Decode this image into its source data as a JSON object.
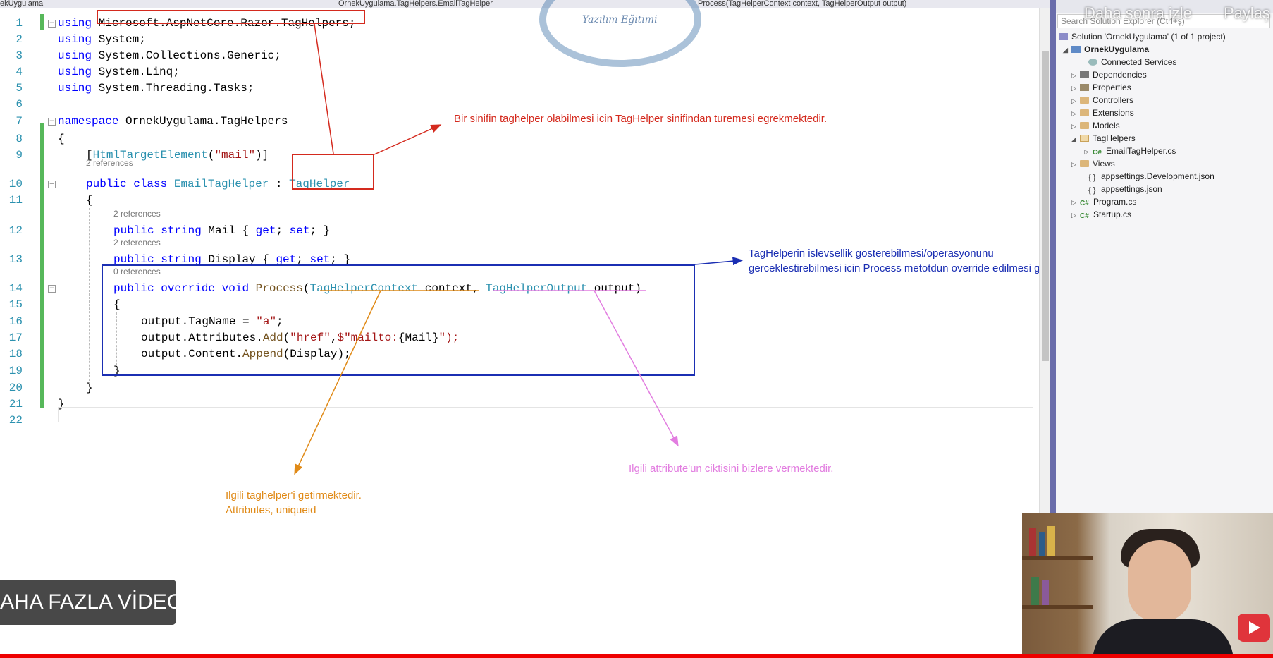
{
  "topbar": {
    "project_tab": "ekUygulama",
    "file_path": "OrnekUygulama.TagHelpers.EmailTagHelper",
    "member_dropdown": "Process(TagHelperContext context, TagHelperOutput output)"
  },
  "youtube": {
    "watch_later": "Daha sonra izle",
    "share": "Paylaş",
    "more_videos": "AHA FAZLA VİDEO"
  },
  "watermark": {
    "subtitle": "Yazılım Eğitimi"
  },
  "code": {
    "line_numbers": [
      "1",
      "2",
      "3",
      "4",
      "5",
      "6",
      "7",
      "8",
      "9",
      "10",
      "11",
      "12",
      "13",
      "14",
      "15",
      "16",
      "17",
      "18",
      "19",
      "20",
      "21",
      "22"
    ],
    "l1": "Microsoft.AspNetCore.Razor.TagHelpers;",
    "l2": "System;",
    "l3": "System.Collections.Generic;",
    "l4": "System.Linq;",
    "l5": "System.Threading.Tasks;",
    "l7": "OrnekUygulama.TagHelpers",
    "l9_attr": "HtmlTargetElement",
    "l9_str": "\"mail\"",
    "l10_class": "EmailTagHelper",
    "l10_base": "TagHelper",
    "l12_prop": " Mail { ",
    "l13_prop": " Display { ",
    "l14_method": "Process",
    "l14_p1type": "TagHelperContext",
    "l14_p1": " context, ",
    "l14_p2type": "TagHelperOutput",
    "l14_p2": " output)",
    "l16": "output.TagName = ",
    "l16_str": "\"a\"",
    "l17a": "output.Attributes.",
    "l17_method": "Add",
    "l17_str1": "\"href\"",
    "l17_str2": "$\"mailto:",
    "l17_interp": "{Mail}",
    "l17_end": "\");",
    "l18a": "output.Content.",
    "l18_method": "Append",
    "l18_end": "(Display);",
    "refs_2": "2 references",
    "refs_0": "0 references",
    "kw_using": "using",
    "kw_namespace": "namespace",
    "kw_public": "public",
    "kw_class": "class",
    "kw_string": "string",
    "kw_override": "override",
    "kw_void": "void",
    "kw_get": "get",
    "kw_set": "set"
  },
  "annotations": {
    "red": "Bir sinifin taghelper olabilmesi icin TagHelper sinifindan turemesi egrekmektedir.",
    "blue_1": "TagHelperin islevsellik gosterebilmesi/operasyonunu",
    "blue_2": "gerceklestirebilmesi icin Process metotdun override edilmesi gerekmektedir.",
    "orange_1": "Ilgili taghelper'i getirmektedir.",
    "orange_2": "Attributes,  uniqueid",
    "pink": "Ilgili attribute'un ciktisini bizlere vermektedir."
  },
  "solution_explorer": {
    "search_placeholder": "Search Solution Explorer (Ctrl+ş)",
    "items": [
      {
        "label": "Solution 'OrnekUygulama' (1 of 1 project)"
      },
      {
        "label": "OrnekUygulama"
      },
      {
        "label": "Connected Services"
      },
      {
        "label": "Dependencies"
      },
      {
        "label": "Properties"
      },
      {
        "label": "Controllers"
      },
      {
        "label": "Extensions"
      },
      {
        "label": "Models"
      },
      {
        "label": "TagHelpers"
      },
      {
        "label": "EmailTagHelper.cs"
      },
      {
        "label": "Views"
      },
      {
        "label": "appsettings.Development.json"
      },
      {
        "label": "appsettings.json"
      },
      {
        "label": "Program.cs"
      },
      {
        "label": "Startup.cs"
      }
    ]
  },
  "colors": {
    "annotation_red": "#d42a1e",
    "annotation_blue": "#1b2fb3",
    "annotation_orange": "#e08a17",
    "annotation_pink": "#e27de0",
    "youtube_red": "#ee0000"
  }
}
